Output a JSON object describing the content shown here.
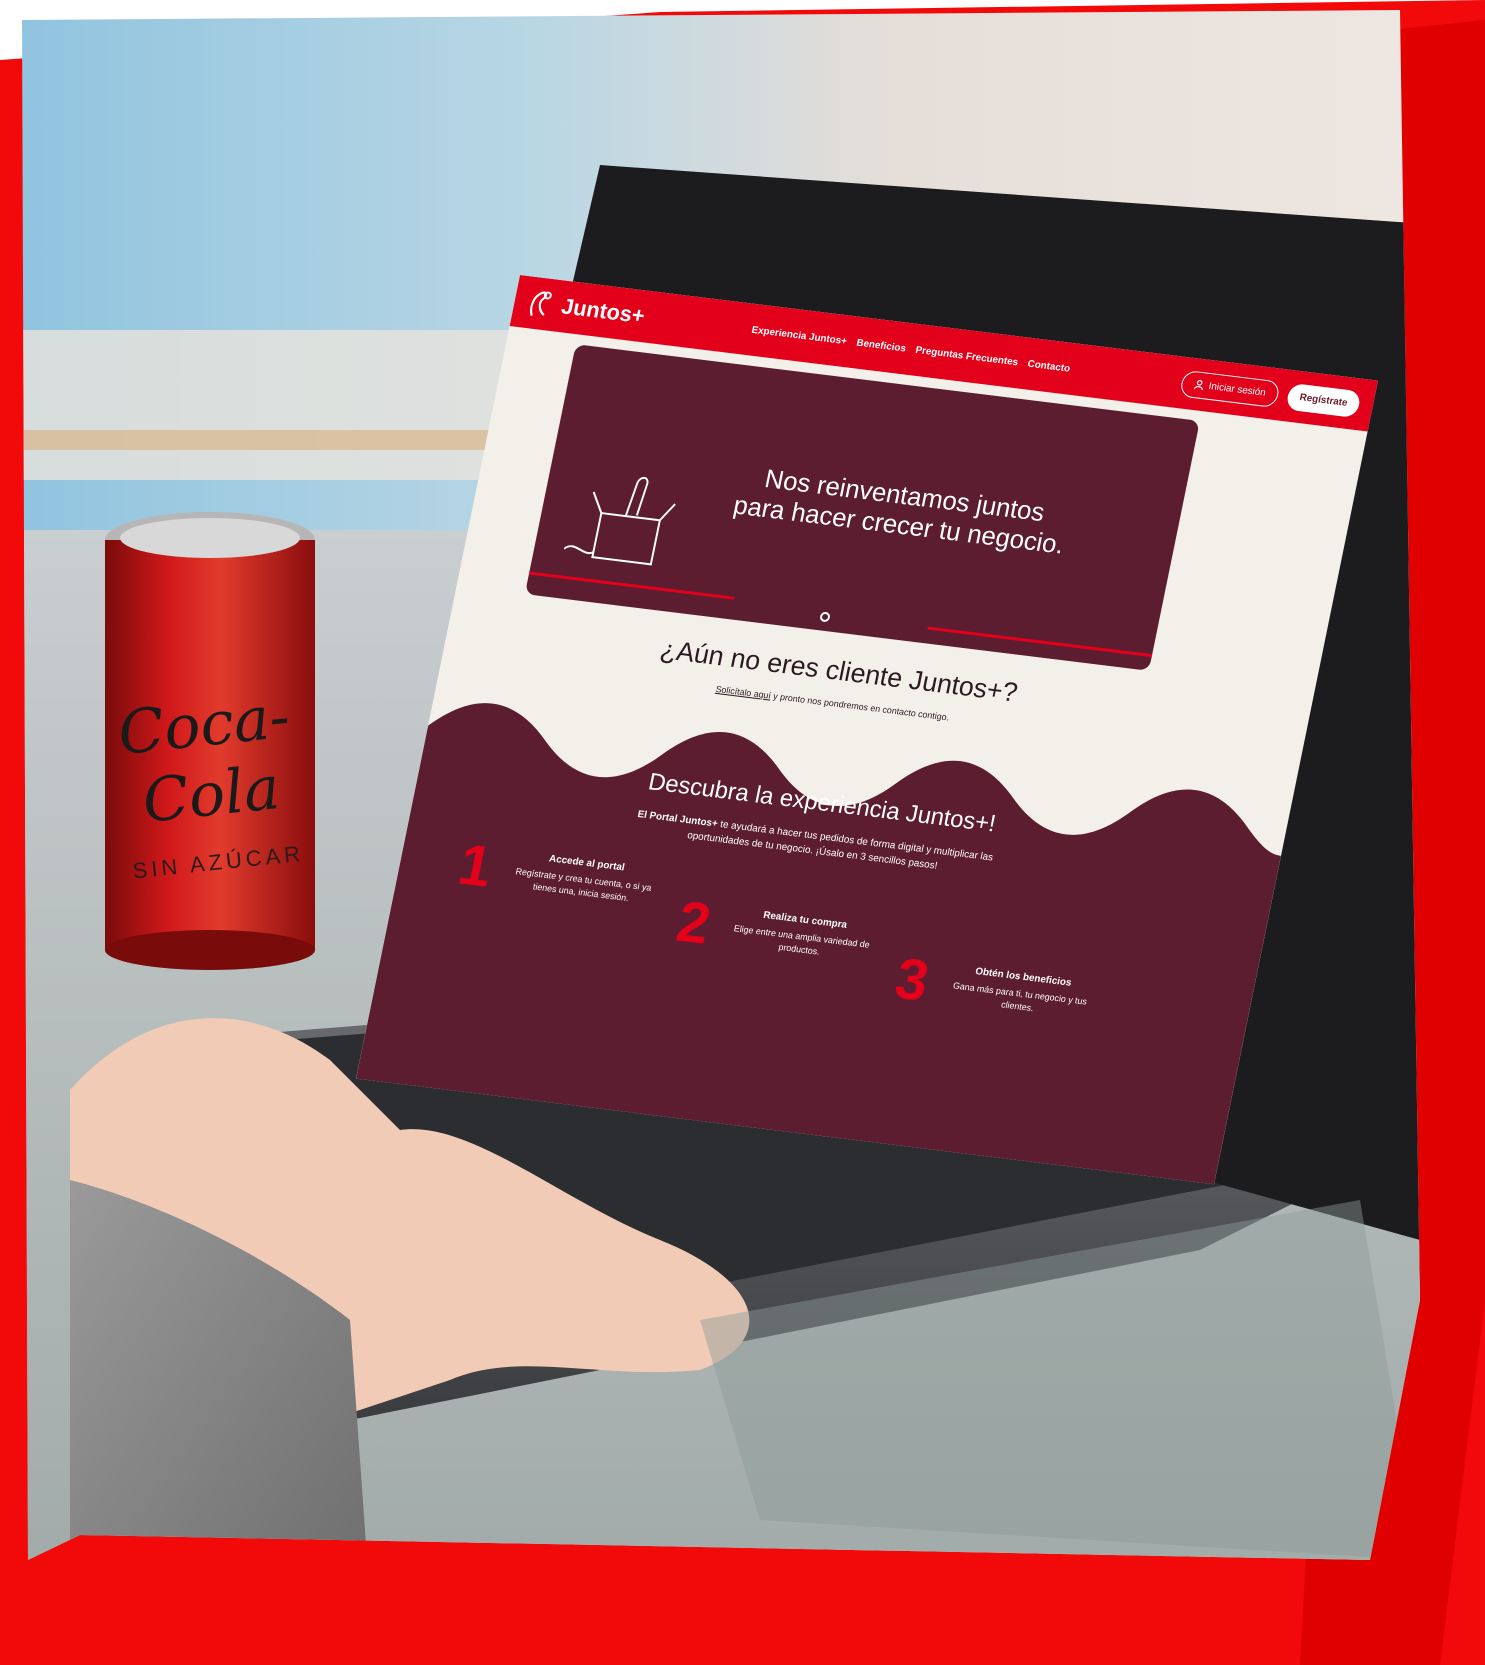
{
  "colors": {
    "brand_red": "#e2001a",
    "maroon": "#5c1d31",
    "cream": "#f3efe9"
  },
  "can": {
    "brand": "Coca-Cola",
    "subtitle": "SIN AZÚCAR"
  },
  "website": {
    "brand_name": "Juntos+",
    "nav": {
      "links": [
        "Experiencia Juntos+",
        "Beneficios",
        "Preguntas Frecuentes",
        "Contacto"
      ],
      "login_label": "Iniciar sesión",
      "register_label": "Regístrate"
    },
    "hero": {
      "title_line_1": "Nos reinventamos juntos",
      "title_line_2": "para hacer crecer tu negocio."
    },
    "cta": {
      "title": "¿Aún no eres cliente Juntos+?",
      "link_label": "Solicítalo aquí",
      "text": "y pronto nos pondremos en contacto contigo."
    },
    "experience": {
      "title": "Descubra la experiencia Juntos+!",
      "desc_bold": "El Portal Juntos+",
      "desc": "te ayudará a hacer tus pedidos de forma digital y multiplicar las oportunidades de tu negocio. ¡Úsalo en 3 sencillos pasos!",
      "steps": [
        {
          "number": "1",
          "title": "Accede al portal",
          "desc": "Regístrate y crea tu cuenta, o si ya tienes una, inicia sesión."
        },
        {
          "number": "2",
          "title": "Realiza tu compra",
          "desc": "Elige entre una amplia variedad de productos."
        },
        {
          "number": "3",
          "title": "Obtén los beneficios",
          "desc": "Gana más para ti, tu negocio y tus clientes."
        }
      ]
    }
  }
}
